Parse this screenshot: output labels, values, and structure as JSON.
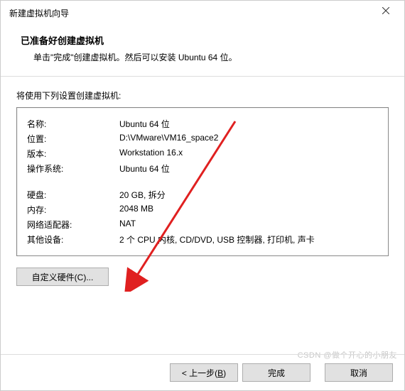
{
  "window": {
    "title": "新建虚拟机向导"
  },
  "header": {
    "title": "已准备好创建虚拟机",
    "subtitle": "单击\"完成\"创建虚拟机。然后可以安装 Ubuntu 64 位。"
  },
  "content": {
    "label": "将使用下列设置创建虚拟机:",
    "settings": {
      "name_label": "名称:",
      "name_value": "Ubuntu 64 位",
      "location_label": "位置:",
      "location_value": "D:\\VMware\\VM16_space2",
      "version_label": "版本:",
      "version_value": "Workstation 16.x",
      "os_label": "操作系统:",
      "os_value": "Ubuntu 64 位",
      "disk_label": "硬盘:",
      "disk_value": "20 GB, 拆分",
      "memory_label": "内存:",
      "memory_value": "2048 MB",
      "network_label": "网络适配器:",
      "network_value": "NAT",
      "other_label": "其他设备:",
      "other_value": "2 个 CPU 内核, CD/DVD, USB 控制器, 打印机, 声卡"
    },
    "customize_button": "自定义硬件(C)..."
  },
  "buttons": {
    "back_pre": "< 上一步(",
    "back_u": "B",
    "back_post": ")",
    "finish": "完成",
    "cancel": "取消"
  },
  "watermark": "CSDN @做个开心的小朋友"
}
